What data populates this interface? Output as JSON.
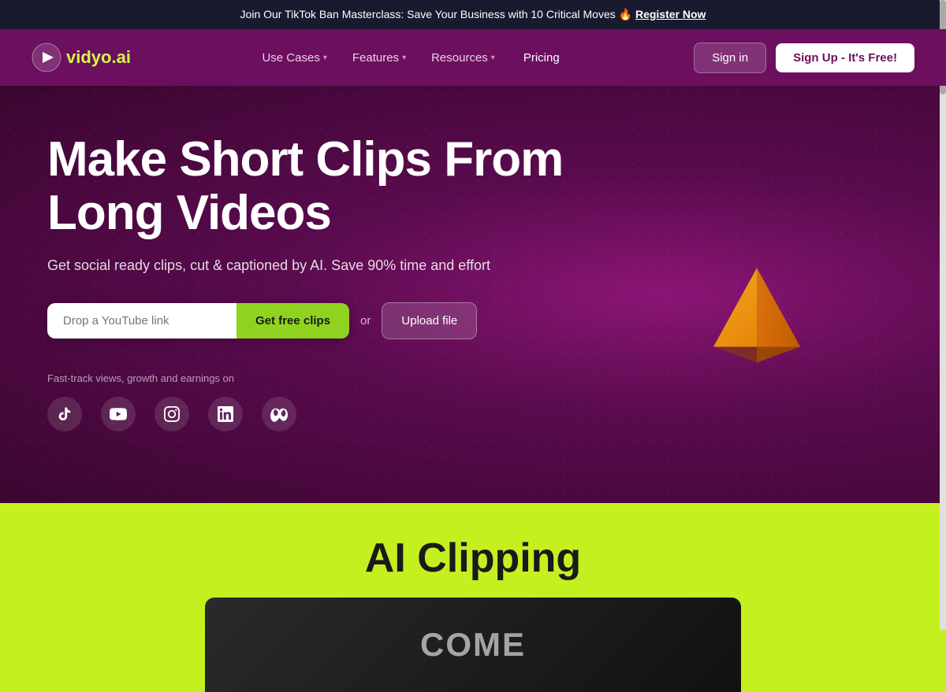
{
  "announcement": {
    "text": "Join Our TikTok Ban Masterclass: Save Your Business with 10 Critical Moves 🔥 ",
    "cta": "Register Now"
  },
  "nav": {
    "logo_name": "vidyo",
    "logo_dot": ".",
    "logo_ai": "ai",
    "use_cases": "Use Cases",
    "features": "Features",
    "resources": "Resources",
    "pricing": "Pricing",
    "signin": "Sign in",
    "signup": "Sign Up - It's Free!"
  },
  "hero": {
    "title": "Make Short Clips From Long Videos",
    "subtitle": "Get social ready clips, cut & captioned by AI. Save 90% time and effort",
    "input_placeholder": "Drop a YouTube link",
    "get_clips_btn": "Get free clips",
    "or_text": "or",
    "upload_btn": "Upload file",
    "fast_track": "Fast-track views, growth and earnings on"
  },
  "social_icons": [
    {
      "name": "tiktok",
      "symbol": "♪"
    },
    {
      "name": "youtube",
      "symbol": "▶"
    },
    {
      "name": "instagram",
      "symbol": "◎"
    },
    {
      "name": "linkedin",
      "symbol": "in"
    },
    {
      "name": "meta",
      "symbol": "∞"
    }
  ],
  "ai_section": {
    "title": "AI Clipping",
    "video_label": "COME"
  },
  "colors": {
    "accent_green": "#8fd320",
    "hero_bg": "#6b1060",
    "announcement_bg": "#1a1a2e"
  }
}
